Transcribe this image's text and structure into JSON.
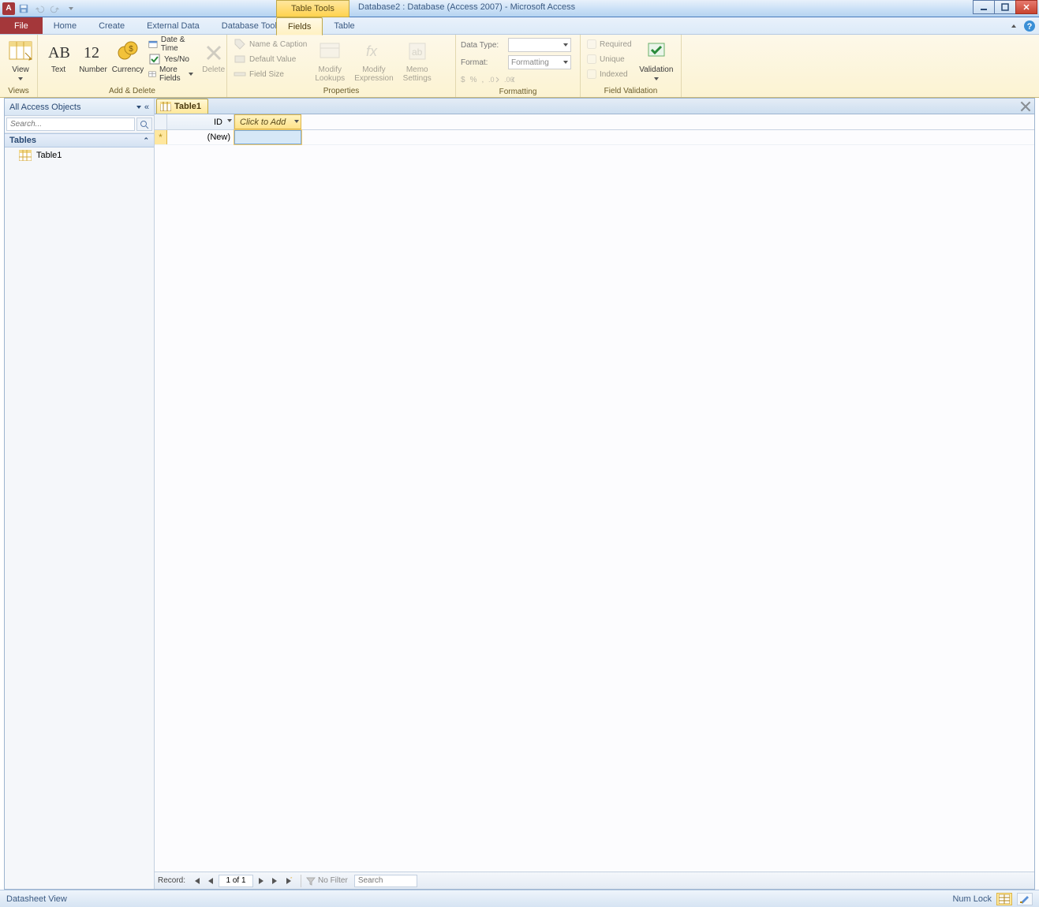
{
  "title": "Database2 : Database (Access 2007)  -  Microsoft Access",
  "contextTab": "Table Tools",
  "tabs": {
    "file": "File",
    "home": "Home",
    "create": "Create",
    "external": "External Data",
    "dbtools": "Database Tools",
    "fields": "Fields",
    "table": "Table"
  },
  "ribbon": {
    "views": {
      "view": "View",
      "label": "Views"
    },
    "addDelete": {
      "text": "Text",
      "number": "Number",
      "currency": "Currency",
      "dateTime": "Date & Time",
      "yesNo": "Yes/No",
      "moreFields": "More Fields",
      "delete": "Delete",
      "label": "Add & Delete"
    },
    "properties": {
      "nameCaption": "Name & Caption",
      "defaultValue": "Default Value",
      "fieldSize": "Field Size",
      "modifyLookups": "Modify\nLookups",
      "modifyExpression": "Modify\nExpression",
      "memoSettings": "Memo\nSettings",
      "label": "Properties"
    },
    "formatting": {
      "dataType": "Data Type:",
      "format": "Format:",
      "formatPlaceholder": "Formatting",
      "label": "Formatting"
    },
    "validation": {
      "required": "Required",
      "unique": "Unique",
      "indexed": "Indexed",
      "validation": "Validation",
      "label": "Field Validation"
    }
  },
  "nav": {
    "header": "All Access Objects",
    "searchPlaceholder": "Search...",
    "group": "Tables",
    "items": [
      "Table1"
    ]
  },
  "doc": {
    "tab": "Table1",
    "colId": "ID",
    "colAdd": "Click to Add",
    "newRow": "(New)"
  },
  "recordNav": {
    "label": "Record:",
    "pos": "1 of 1",
    "noFilter": "No Filter",
    "searchPlaceholder": "Search"
  },
  "status": {
    "left": "Datasheet View",
    "numlock": "Num Lock"
  }
}
